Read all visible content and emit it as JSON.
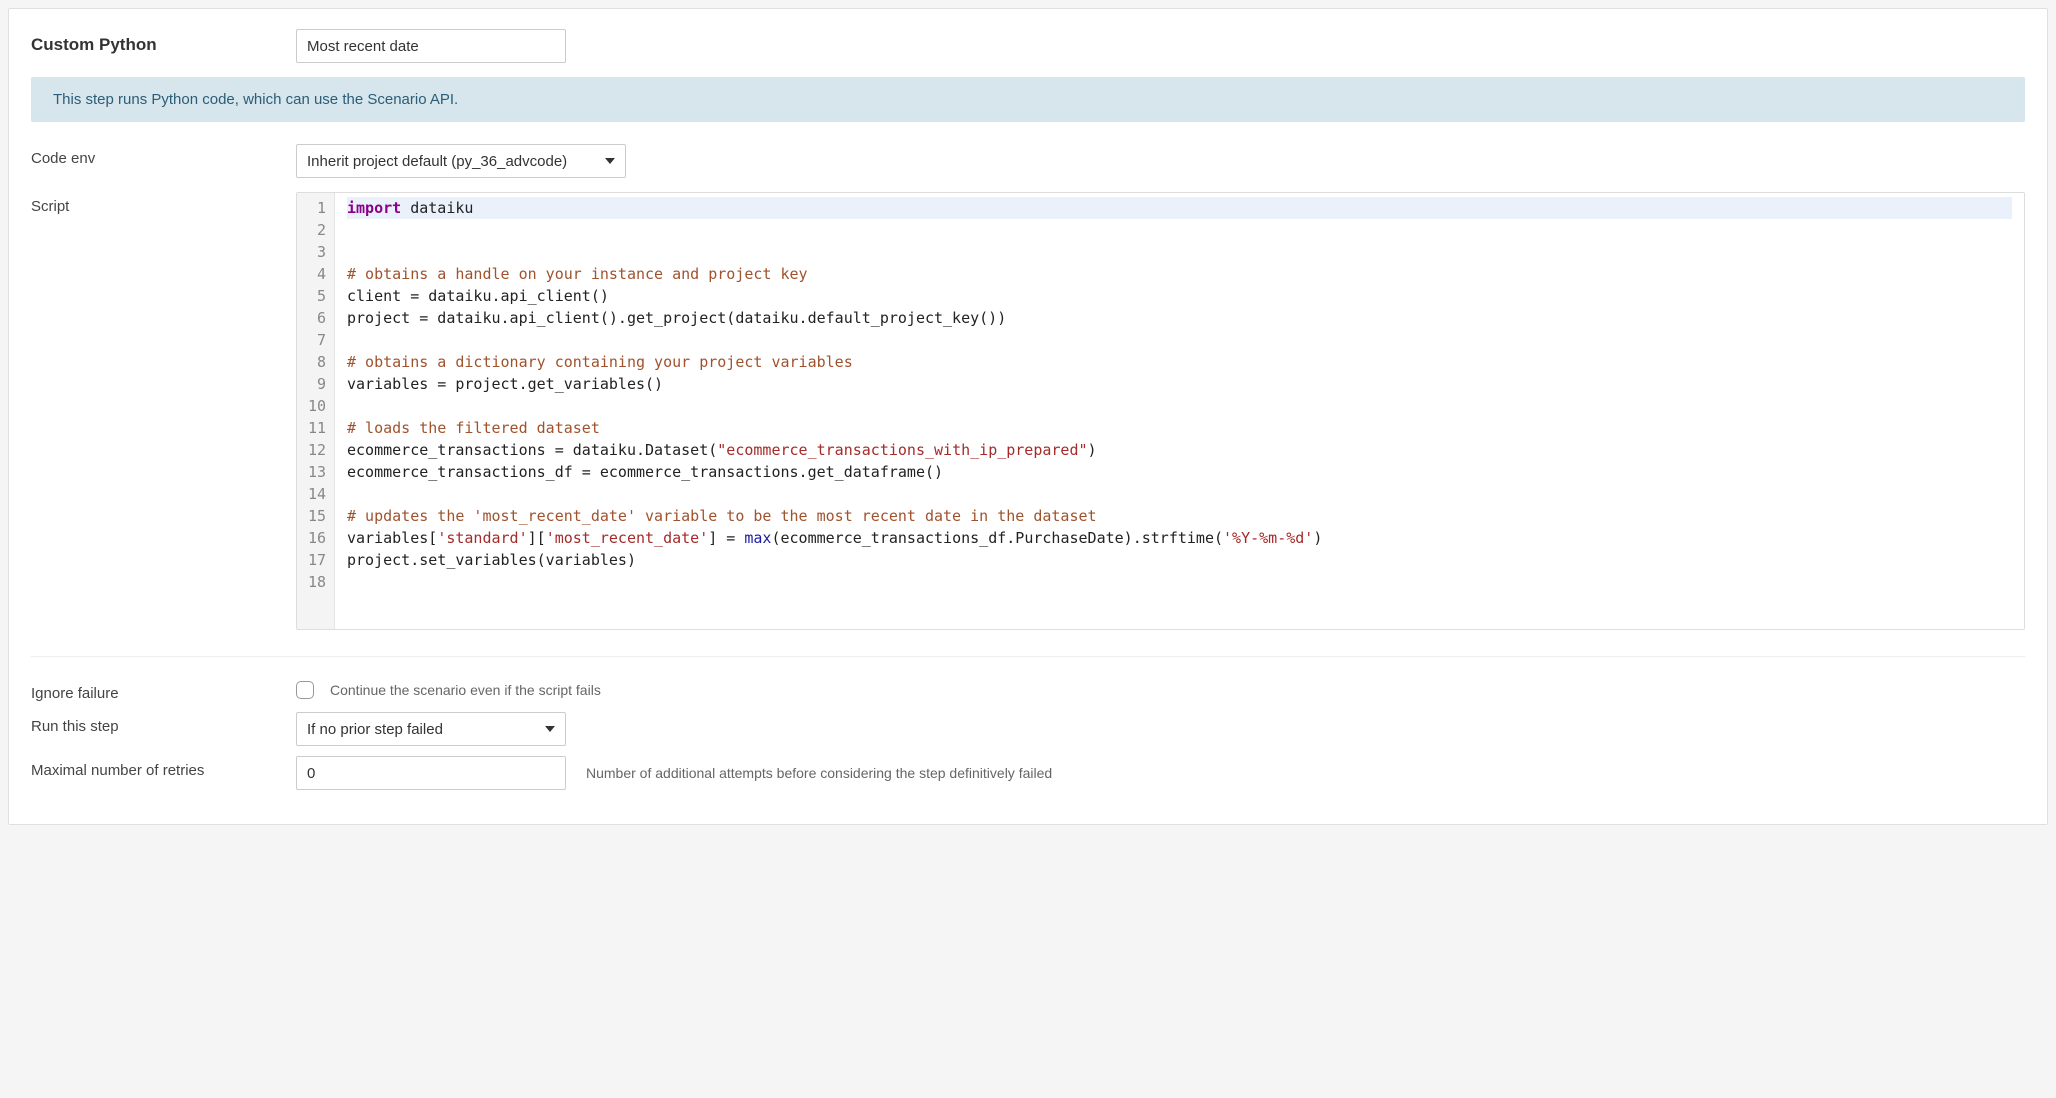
{
  "header": {
    "title": "Custom Python",
    "step_name": "Most recent date"
  },
  "banner": {
    "text": "This step runs Python code, which can use the Scenario API."
  },
  "code_env": {
    "label": "Code env",
    "selected": "Inherit project default (py_36_advcode)"
  },
  "script": {
    "label": "Script",
    "lines": [
      {
        "n": 1,
        "hl": true,
        "tokens": [
          [
            "kw",
            "import"
          ],
          [
            "sp",
            " "
          ],
          [
            "id",
            "dataiku"
          ]
        ]
      },
      {
        "n": 2,
        "tokens": []
      },
      {
        "n": 3,
        "tokens": []
      },
      {
        "n": 4,
        "tokens": [
          [
            "cm",
            "# obtains a handle on your instance and project key"
          ]
        ]
      },
      {
        "n": 5,
        "tokens": [
          [
            "id",
            "client = dataiku.api_client()"
          ]
        ]
      },
      {
        "n": 6,
        "tokens": [
          [
            "id",
            "project = dataiku.api_client().get_project(dataiku.default_project_key())"
          ]
        ]
      },
      {
        "n": 7,
        "tokens": []
      },
      {
        "n": 8,
        "tokens": [
          [
            "cm",
            "# obtains a dictionary containing your project variables"
          ]
        ]
      },
      {
        "n": 9,
        "tokens": [
          [
            "id",
            "variables = project.get_variables()"
          ]
        ]
      },
      {
        "n": 10,
        "tokens": []
      },
      {
        "n": 11,
        "tokens": [
          [
            "cm",
            "# loads the filtered dataset"
          ]
        ]
      },
      {
        "n": 12,
        "tokens": [
          [
            "id",
            "ecommerce_transactions = dataiku.Dataset("
          ],
          [
            "str",
            "\"ecommerce_transactions_with_ip_prepared\""
          ],
          [
            "id",
            ")"
          ]
        ]
      },
      {
        "n": 13,
        "tokens": [
          [
            "id",
            "ecommerce_transactions_df = ecommerce_transactions.get_dataframe()"
          ]
        ]
      },
      {
        "n": 14,
        "tokens": []
      },
      {
        "n": 15,
        "tokens": [
          [
            "cm",
            "# updates the 'most_recent_date' variable to be the most recent date in the dataset"
          ]
        ]
      },
      {
        "n": 16,
        "tokens": [
          [
            "id",
            "variables["
          ],
          [
            "str",
            "'standard'"
          ],
          [
            "id",
            "]["
          ],
          [
            "str",
            "'most_recent_date'"
          ],
          [
            "id",
            "] = "
          ],
          [
            "fn",
            "max"
          ],
          [
            "id",
            "(ecommerce_transactions_df.PurchaseDate).strftime("
          ],
          [
            "str",
            "'%Y-%m-%d'"
          ],
          [
            "id",
            ")"
          ]
        ]
      },
      {
        "n": 17,
        "tokens": [
          [
            "id",
            "project.set_variables(variables)"
          ]
        ]
      },
      {
        "n": 18,
        "tokens": []
      }
    ]
  },
  "ignore_failure": {
    "label": "Ignore failure",
    "checked": false,
    "hint": "Continue the scenario even if the script fails"
  },
  "run_step": {
    "label": "Run this step",
    "selected": "If no prior step failed"
  },
  "retries": {
    "label": "Maximal number of retries",
    "value": "0",
    "hint": "Number of additional attempts before considering the step definitively failed"
  }
}
